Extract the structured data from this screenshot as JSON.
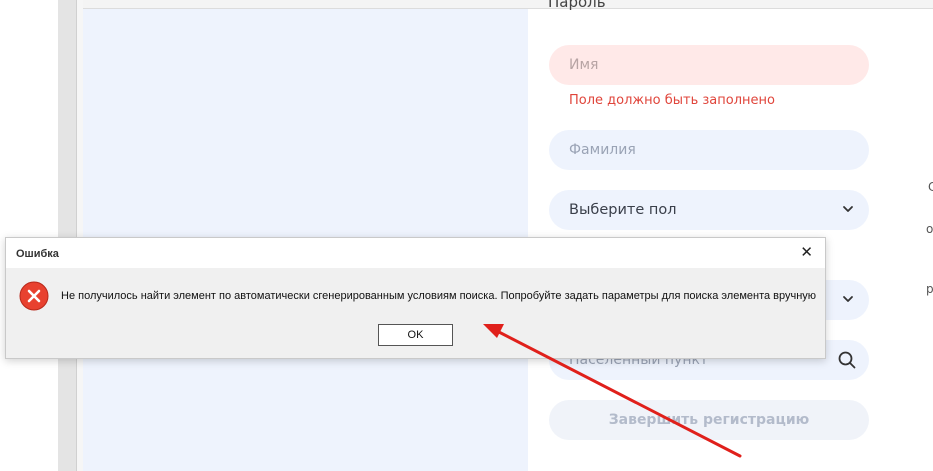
{
  "form": {
    "cut_label": "Пароль",
    "first_name_placeholder": "Имя",
    "first_name_error": "Поле должно быть заполнено",
    "last_name_placeholder": "Фамилия",
    "gender_select_value": "Выберите пол",
    "city_placeholder": "Населенный пункт",
    "submit_label": "Завершить регистрацию"
  },
  "side_chars": [
    "С",
    "о",
    "р"
  ],
  "dialog": {
    "title": "Ошибка",
    "close_glyph": "✕",
    "message": "Не получилось найти элемент по автоматически сгенерированным условиям поиска. Попробуйте задать параметры для поиска элемента вручную",
    "ok_label": "OK"
  },
  "colors": {
    "error_red": "#e0453b",
    "arrow_red": "#e0201b",
    "pill_bg": "#eef3fd",
    "error_pill_bg": "#ffe9e8"
  },
  "icons": [
    "error-icon",
    "close-icon",
    "chevron-down-icon",
    "search-icon",
    "annotation-arrow"
  ]
}
